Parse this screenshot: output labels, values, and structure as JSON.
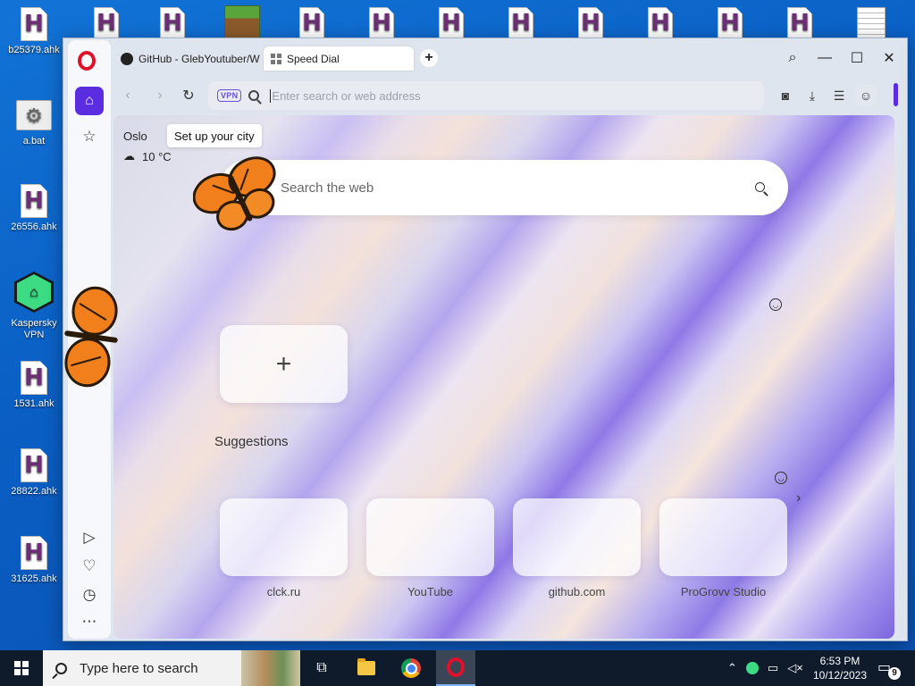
{
  "desktop": {
    "left_icons": [
      {
        "label": "b25379.ahk",
        "kind": "ahk"
      },
      {
        "label": "a.bat",
        "kind": "bat"
      },
      {
        "label": "26556.ahk",
        "kind": "ahk"
      },
      {
        "label": "Kaspersky VPN",
        "kind": "vpn"
      },
      {
        "label": "1531.ahk",
        "kind": "ahk"
      },
      {
        "label": "28822.ahk",
        "kind": "ahk"
      },
      {
        "label": "31625.ahk",
        "kind": "ahk"
      }
    ]
  },
  "browser": {
    "tabs": [
      {
        "label": "GitHub - GlebYoutuber/W",
        "icon": "github-icon"
      },
      {
        "label": "Speed Dial",
        "icon": "speed-dial-icon",
        "active": true
      }
    ],
    "address_bar": {
      "vpn_label": "VPN",
      "placeholder": "Enter search or web address",
      "value": ""
    },
    "accent_color": "#5a2ee0"
  },
  "speed_dial": {
    "city": "Oslo",
    "city_tooltip": "Set up your city",
    "weather": "10 °C",
    "search_placeholder": "Search the web",
    "add_tile": "+",
    "suggestions_title": "Suggestions",
    "suggestions": [
      {
        "label": "clck.ru"
      },
      {
        "label": "YouTube"
      },
      {
        "label": "github.com"
      },
      {
        "label": "ProGrovv Studio"
      }
    ]
  },
  "taskbar": {
    "search_placeholder": "Type here to search",
    "time": "6:53 PM",
    "date": "10/12/2023",
    "notification_count": "9"
  }
}
